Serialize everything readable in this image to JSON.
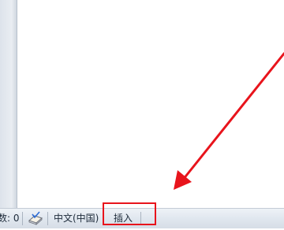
{
  "statusbar": {
    "word_count": "数: 0",
    "proofing_icon": "spellcheck-book-icon",
    "language": "中文(中国)",
    "insert_mode": "插入"
  },
  "annotation": {
    "color": "#e8141c"
  }
}
